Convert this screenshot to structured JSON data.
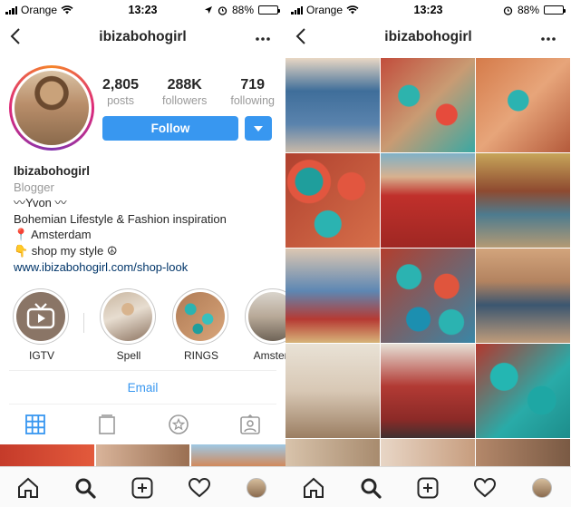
{
  "status_left": {
    "carrier": "Orange",
    "time": "13:23",
    "battery": "88%",
    "battery_level": 0.88
  },
  "status_right": {
    "carrier": "Orange",
    "time": "13:23",
    "battery": "88%",
    "battery_level": 0.88
  },
  "profile": {
    "username": "ibizabohogirl",
    "stats": [
      {
        "value": "2,805",
        "label": "posts"
      },
      {
        "value": "288K",
        "label": "followers"
      },
      {
        "value": "719",
        "label": "following"
      }
    ],
    "follow_label": "Follow",
    "bio": {
      "name": "Ibizabohogirl",
      "category": "Blogger",
      "lines": [
        "〰Yvon 〰",
        "Bohemian Lifestyle & Fashion inspiration",
        "📍 Amsterdam",
        "👇 shop my style ☮"
      ],
      "link": "www.ibizabohogirl.com/shop-look"
    },
    "highlights": [
      {
        "label": "IGTV",
        "icon": "igtv-icon"
      },
      {
        "label": "Spell",
        "icon": "photo"
      },
      {
        "label": "RINGS",
        "icon": "photo"
      },
      {
        "label": "Amsterd",
        "icon": "photo"
      }
    ],
    "email_label": "Email",
    "tabs": [
      "grid-icon",
      "feed-icon",
      "saved-star-icon",
      "tagged-icon"
    ]
  },
  "grid_username": "ibizabohogirl",
  "bottom_nav": [
    "home-icon",
    "search-icon",
    "add-post-icon",
    "activity-heart-icon",
    "profile-avatar"
  ],
  "colors": {
    "accent": "#3897f0",
    "link": "#003569",
    "muted": "#999999"
  }
}
